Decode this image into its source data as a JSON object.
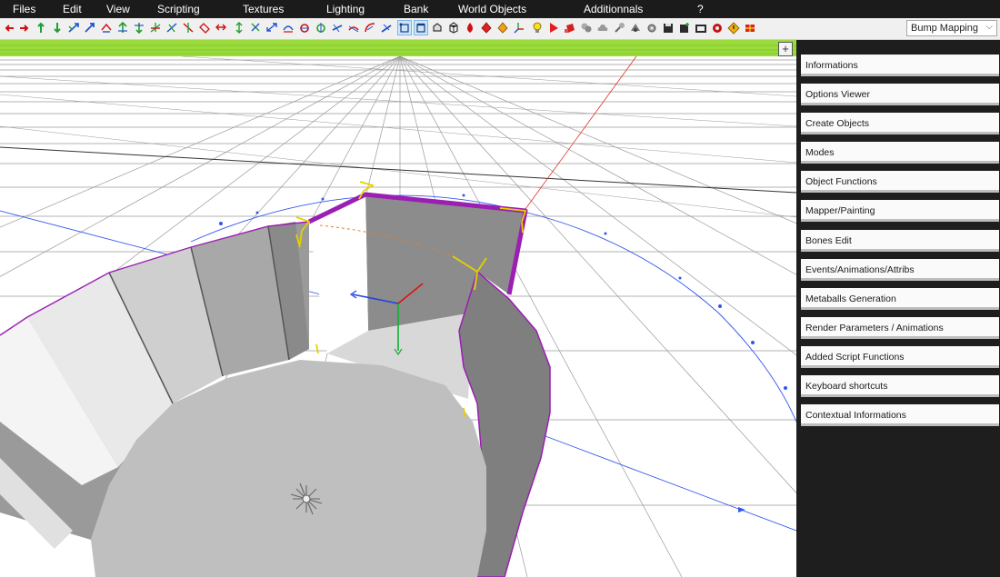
{
  "menu": {
    "items": [
      {
        "label": "Files"
      },
      {
        "label": "Edit"
      },
      {
        "label": "View"
      },
      {
        "label": "Scripting"
      },
      {
        "label": "Textures"
      },
      {
        "label": "Lighting"
      },
      {
        "label": "Bank"
      },
      {
        "label": "World Objects"
      },
      {
        "label": "Additionnals"
      },
      {
        "label": "?"
      }
    ]
  },
  "toolbar": {
    "render_mode": "Bump Mapping"
  },
  "viewport": {
    "add_label": "+"
  },
  "panel": {
    "items": [
      {
        "label": "Informations"
      },
      {
        "label": "Options Viewer"
      },
      {
        "label": "Create Objects"
      },
      {
        "label": "Modes"
      },
      {
        "label": "Object Functions"
      },
      {
        "label": "Mapper/Painting"
      },
      {
        "label": "Bones Edit"
      },
      {
        "label": "Events/Animations/Attribs"
      },
      {
        "label": "Metaballs Generation"
      },
      {
        "label": "Render Parameters / Animations"
      },
      {
        "label": "Added Script Functions"
      },
      {
        "label": "Keyboard shortcuts"
      },
      {
        "label": "Contextual Informations"
      }
    ]
  },
  "colors": {
    "ground_strip": "#9bdc3c",
    "selection_edge": "#9a1fb2",
    "path_curve": "#3355ee",
    "axis_x": "#e01010",
    "axis_y": "#10b030",
    "axis_z": "#2040e0",
    "gizmo": "#e6d000"
  }
}
